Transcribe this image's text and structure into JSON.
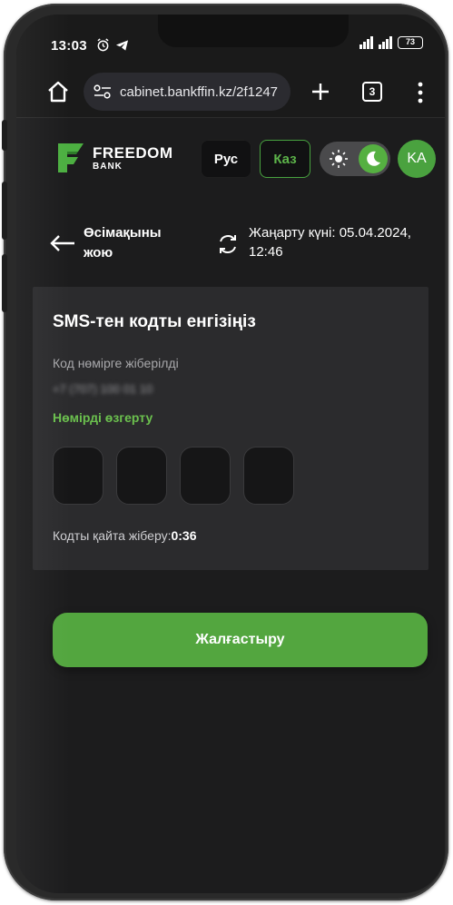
{
  "status_bar": {
    "time": "13:03",
    "battery": "73"
  },
  "browser": {
    "url": "cabinet.bankffin.kz/2f1247",
    "tab_count": "3"
  },
  "header": {
    "logo_line1": "FREEDOM",
    "logo_line2": "BANK",
    "lang_ru": "Рус",
    "lang_kz": "Каз",
    "avatar_initials": "KA"
  },
  "title_row": {
    "back_label": "Өсімақыны жою",
    "update_text": "Жаңарту күні: 05.04.2024, 12:46"
  },
  "sms_card": {
    "title": "SMS-тен кодты енгізіңіз",
    "sent_label": "Код нөмірге жіберілді",
    "phone_masked": "+7 (707) 100 01 10",
    "change_number": "Нөмірді өзгерту",
    "resend_label": "Кодты қайта жіберу:",
    "resend_timer": "0:36"
  },
  "continue_label": "Жалғастыру",
  "colors": {
    "accent": "#53a63f",
    "background": "#1c1c1d",
    "card": "#2b2b2d"
  }
}
